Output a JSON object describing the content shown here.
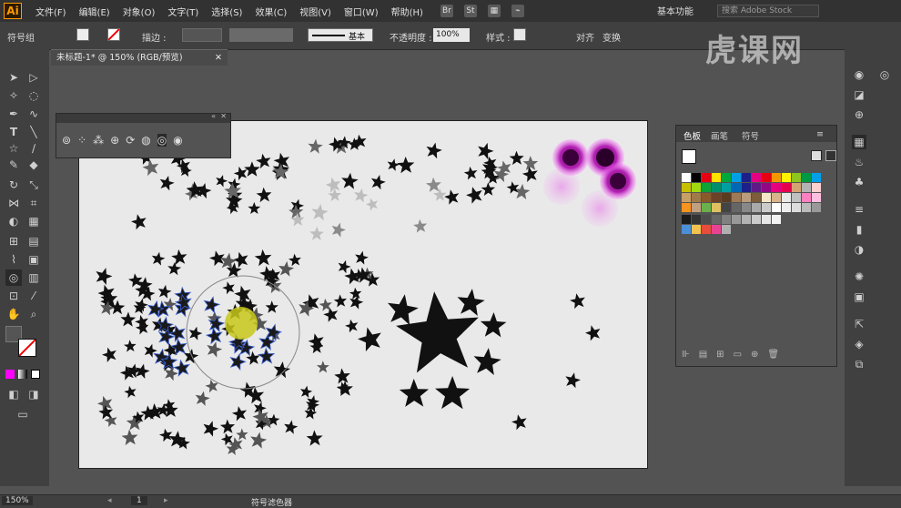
{
  "app": {
    "logo": "Ai"
  },
  "menu": [
    "文件(F)",
    "编辑(E)",
    "对象(O)",
    "文字(T)",
    "选择(S)",
    "效果(C)",
    "视图(V)",
    "窗口(W)",
    "帮助(H)"
  ],
  "menubar_icons": [
    "Br",
    "St",
    "▦",
    "⌁"
  ],
  "workspace": "基本功能",
  "stock_search_placeholder": "搜索 Adobe Stock",
  "control": {
    "selection_label": "符号组",
    "stroke_label": "描边 :",
    "stroke_style": "基本",
    "opacity_label": "不透明度 :",
    "opacity_value": "100%",
    "style_label": "样式 :",
    "align_button": "对齐",
    "transform_button": "变换"
  },
  "watermark": "虎课网",
  "document": {
    "tab_title": "未标题-1* @ 150% (RGB/预览)"
  },
  "swatch_panel": {
    "tabs": [
      "色板",
      "画笔",
      "符号"
    ]
  },
  "status": {
    "zoom": "150%",
    "page": "1",
    "tool_name": "符号滤色器"
  },
  "icons": {
    "toolbar": [
      "selection-icon",
      "direct-selection-icon",
      "magic-wand-icon",
      "lasso-icon",
      "pen-icon",
      "curvature-icon",
      "type-icon",
      "line-icon",
      "rectangle-icon",
      "paintbrush-icon",
      "shaper-icon",
      "eraser-icon",
      "rotate-icon",
      "scale-icon",
      "width-icon",
      "free-transform-icon",
      "shape-builder-icon",
      "perspective-icon",
      "mesh-icon",
      "gradient-icon",
      "eyedropper-icon",
      "blend-icon",
      "symbol-sprayer-icon",
      "column-graph-icon",
      "artboard-icon",
      "slice-icon",
      "hand-icon",
      "zoom-icon"
    ],
    "symbolism": [
      "symbol-sprayer-icon",
      "symbol-shifter-icon",
      "symbol-scruncher-icon",
      "symbol-sizer-icon",
      "symbol-spinner-icon",
      "symbol-stainer-icon",
      "symbol-screener-icon",
      "symbol-styler-icon"
    ],
    "dock": [
      "color-icon",
      "color-guide-icon",
      "swatches-icon",
      "brushes-icon",
      "symbols-icon",
      "stroke-icon",
      "gradient-icon",
      "transparency-icon",
      "appearance-icon",
      "graphic-styles-icon",
      "layers-icon",
      "artboards-icon",
      "transform-icon",
      "align-icon"
    ]
  },
  "colors": {
    "ui_dark": "#323232",
    "ui_panel": "#535353",
    "artboard": "#e9e9e9",
    "highlight": "#c8c81a",
    "flower": "#d63ad6"
  }
}
